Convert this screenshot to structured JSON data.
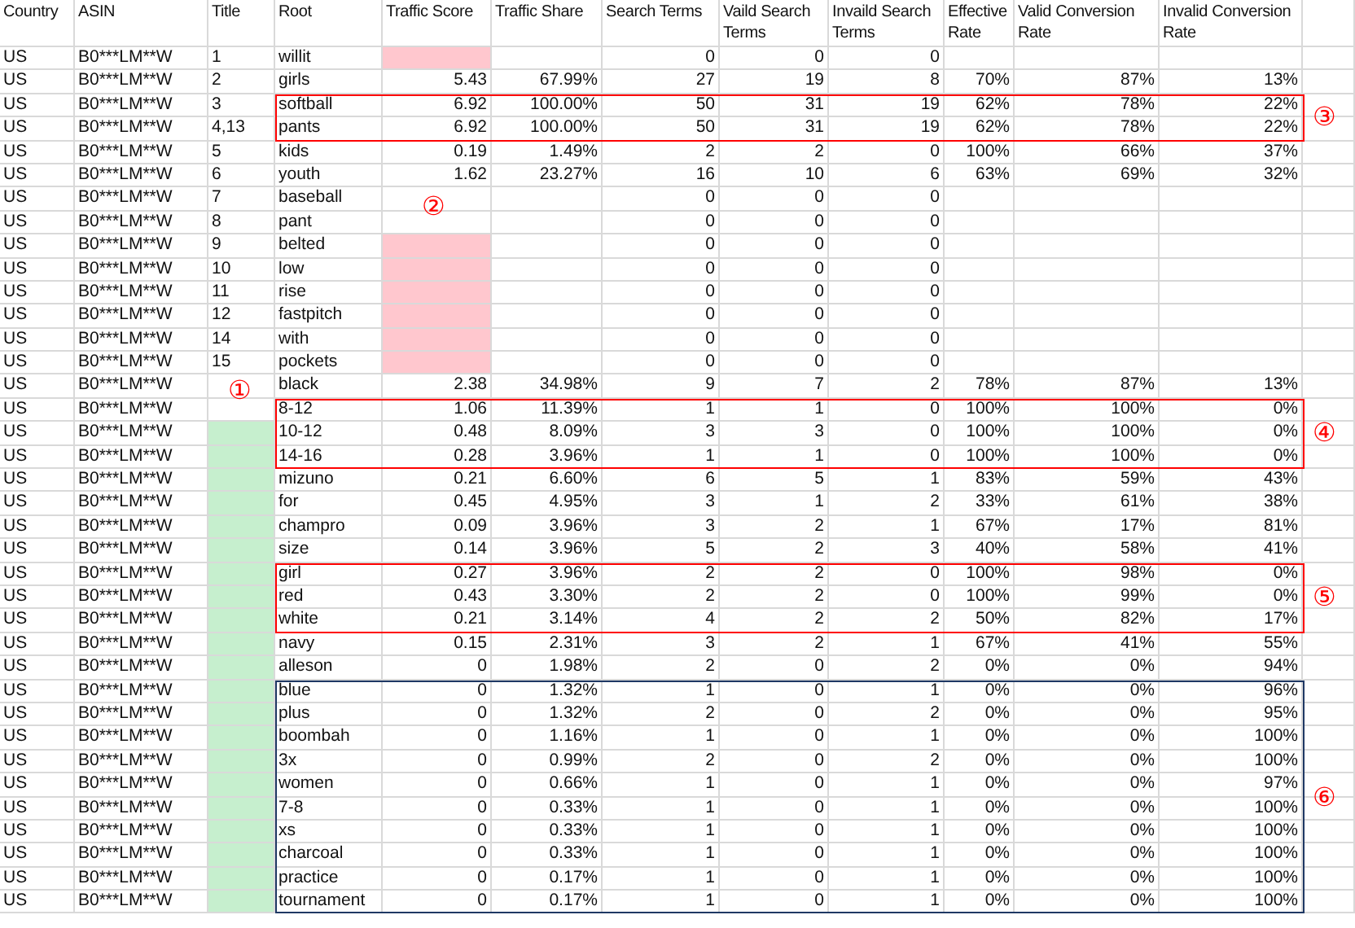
{
  "table": {
    "columns": [
      {
        "label": "Country"
      },
      {
        "label": "ASIN"
      },
      {
        "label": "Title"
      },
      {
        "label": "Root"
      },
      {
        "label": "Traffic Score"
      },
      {
        "label": "Traffic Share"
      },
      {
        "label": "Search Terms"
      },
      {
        "label": "Vaild Search Terms"
      },
      {
        "label": "Invaild Search Terms"
      },
      {
        "label": "Effective Rate"
      },
      {
        "label": "Valid Conversion Rate"
      },
      {
        "label": "Invalid Conversion Rate"
      }
    ],
    "sections": [
      {
        "rows": [
          {
            "country": "US",
            "asin": "B0***LM**W",
            "title": "1",
            "root": "willit",
            "score_highlight": true,
            "title_highlight": false,
            "search_terms": "0",
            "valid_search_terms": "0",
            "invalid_search_terms": "0"
          },
          {
            "country": "US",
            "asin": "B0***LM**W",
            "title": "2",
            "root": "girls",
            "score_highlight": false,
            "title_highlight": false,
            "traffic_score": "5.43",
            "traffic_share": "67.99%",
            "search_terms": "27",
            "valid_search_terms": "19",
            "invalid_search_terms": "8",
            "effective_rate": "70%",
            "valid_conversion_rate": "87%",
            "invalid_conversion_rate": "13%"
          }
        ]
      },
      {
        "box": {
          "label": "③",
          "color": "#ff0000"
        },
        "rows": [
          {
            "country": "US",
            "asin": "B0***LM**W",
            "title": "3",
            "root": "softball",
            "score_highlight": false,
            "title_highlight": false,
            "traffic_score": "6.92",
            "traffic_share": "100.00%",
            "search_terms": "50",
            "valid_search_terms": "31",
            "invalid_search_terms": "19",
            "effective_rate": "62%",
            "valid_conversion_rate": "78%",
            "invalid_conversion_rate": "22%"
          },
          {
            "country": "US",
            "asin": "B0***LM**W",
            "title": "4,13",
            "root": "pants",
            "score_highlight": false,
            "title_highlight": false,
            "traffic_score": "6.92",
            "traffic_share": "100.00%",
            "search_terms": "50",
            "valid_search_terms": "31",
            "invalid_search_terms": "19",
            "effective_rate": "62%",
            "valid_conversion_rate": "78%",
            "invalid_conversion_rate": "22%"
          }
        ]
      },
      {
        "rows": [
          {
            "country": "US",
            "asin": "B0***LM**W",
            "title": "5",
            "root": "kids",
            "score_highlight": false,
            "title_highlight": false,
            "traffic_score": "0.19",
            "traffic_share": "1.49%",
            "search_terms": "2",
            "valid_search_terms": "2",
            "invalid_search_terms": "0",
            "effective_rate": "100%",
            "valid_conversion_rate": "66%",
            "invalid_conversion_rate": "37%"
          },
          {
            "country": "US",
            "asin": "B0***LM**W",
            "title": "6",
            "root": "youth",
            "score_highlight": false,
            "title_highlight": false,
            "traffic_score": "1.62",
            "traffic_share": "23.27%",
            "search_terms": "16",
            "valid_search_terms": "10",
            "invalid_search_terms": "6",
            "effective_rate": "63%",
            "valid_conversion_rate": "69%",
            "invalid_conversion_rate": "32%"
          },
          {
            "country": "US",
            "asin": "B0***LM**W",
            "title": "7",
            "root": "baseball",
            "score_highlight": false,
            "title_highlight": false,
            "score_note": "②",
            "search_terms": "0",
            "valid_search_terms": "0",
            "invalid_search_terms": "0"
          },
          {
            "country": "US",
            "asin": "B0***LM**W",
            "title": "8",
            "root": "pant",
            "score_highlight": false,
            "title_highlight": false,
            "search_terms": "0",
            "valid_search_terms": "0",
            "invalid_search_terms": "0"
          },
          {
            "country": "US",
            "asin": "B0***LM**W",
            "title": "9",
            "root": "belted",
            "score_highlight": true,
            "title_highlight": false,
            "search_terms": "0",
            "valid_search_terms": "0",
            "invalid_search_terms": "0"
          },
          {
            "country": "US",
            "asin": "B0***LM**W",
            "title": "10",
            "root": "low",
            "score_highlight": true,
            "title_highlight": false,
            "search_terms": "0",
            "valid_search_terms": "0",
            "invalid_search_terms": "0"
          },
          {
            "country": "US",
            "asin": "B0***LM**W",
            "title": "11",
            "root": "rise",
            "score_highlight": true,
            "title_highlight": false,
            "search_terms": "0",
            "valid_search_terms": "0",
            "invalid_search_terms": "0"
          },
          {
            "country": "US",
            "asin": "B0***LM**W",
            "title": "12",
            "root": "fastpitch",
            "score_highlight": true,
            "title_highlight": false,
            "search_terms": "0",
            "valid_search_terms": "0",
            "invalid_search_terms": "0"
          },
          {
            "country": "US",
            "asin": "B0***LM**W",
            "title": "14",
            "root": "with",
            "score_highlight": true,
            "title_highlight": false,
            "search_terms": "0",
            "valid_search_terms": "0",
            "invalid_search_terms": "0"
          },
          {
            "country": "US",
            "asin": "B0***LM**W",
            "title": "15",
            "root": "pockets",
            "score_highlight": true,
            "title_highlight": false,
            "search_terms": "0",
            "valid_search_terms": "0",
            "invalid_search_terms": "0"
          },
          {
            "country": "US",
            "asin": "B0***LM**W",
            "root": "black",
            "score_highlight": false,
            "title_highlight": false,
            "title_note": "①",
            "traffic_score": "2.38",
            "traffic_share": "34.98%",
            "search_terms": "9",
            "valid_search_terms": "7",
            "invalid_search_terms": "2",
            "effective_rate": "78%",
            "valid_conversion_rate": "87%",
            "invalid_conversion_rate": "13%"
          }
        ]
      },
      {
        "box": {
          "label": "④",
          "color": "#ff0000"
        },
        "rows": [
          {
            "country": "US",
            "asin": "B0***LM**W",
            "root": "8-12",
            "score_highlight": false,
            "title_highlight": false,
            "traffic_score": "1.06",
            "traffic_share": "11.39%",
            "search_terms": "1",
            "valid_search_terms": "1",
            "invalid_search_terms": "0",
            "effective_rate": "100%",
            "valid_conversion_rate": "100%",
            "invalid_conversion_rate": "0%"
          },
          {
            "country": "US",
            "asin": "B0***LM**W",
            "root": "10-12",
            "score_highlight": false,
            "title_highlight": true,
            "traffic_score": "0.48",
            "traffic_share": "8.09%",
            "search_terms": "3",
            "valid_search_terms": "3",
            "invalid_search_terms": "0",
            "effective_rate": "100%",
            "valid_conversion_rate": "100%",
            "invalid_conversion_rate": "0%"
          },
          {
            "country": "US",
            "asin": "B0***LM**W",
            "root": "14-16",
            "score_highlight": false,
            "title_highlight": true,
            "traffic_score": "0.28",
            "traffic_share": "3.96%",
            "search_terms": "1",
            "valid_search_terms": "1",
            "invalid_search_terms": "0",
            "effective_rate": "100%",
            "valid_conversion_rate": "100%",
            "invalid_conversion_rate": "0%"
          }
        ]
      },
      {
        "rows": [
          {
            "country": "US",
            "asin": "B0***LM**W",
            "root": "mizuno",
            "score_highlight": false,
            "title_highlight": true,
            "traffic_score": "0.21",
            "traffic_share": "6.60%",
            "search_terms": "6",
            "valid_search_terms": "5",
            "invalid_search_terms": "1",
            "effective_rate": "83%",
            "valid_conversion_rate": "59%",
            "invalid_conversion_rate": "43%"
          },
          {
            "country": "US",
            "asin": "B0***LM**W",
            "root": "for",
            "score_highlight": false,
            "title_highlight": true,
            "traffic_score": "0.45",
            "traffic_share": "4.95%",
            "search_terms": "3",
            "valid_search_terms": "1",
            "invalid_search_terms": "2",
            "effective_rate": "33%",
            "valid_conversion_rate": "61%",
            "invalid_conversion_rate": "38%"
          },
          {
            "country": "US",
            "asin": "B0***LM**W",
            "root": "champro",
            "score_highlight": false,
            "title_highlight": true,
            "traffic_score": "0.09",
            "traffic_share": "3.96%",
            "search_terms": "3",
            "valid_search_terms": "2",
            "invalid_search_terms": "1",
            "effective_rate": "67%",
            "valid_conversion_rate": "17%",
            "invalid_conversion_rate": "81%"
          },
          {
            "country": "US",
            "asin": "B0***LM**W",
            "root": "size",
            "score_highlight": false,
            "title_highlight": true,
            "traffic_score": "0.14",
            "traffic_share": "3.96%",
            "search_terms": "5",
            "valid_search_terms": "2",
            "invalid_search_terms": "3",
            "effective_rate": "40%",
            "valid_conversion_rate": "58%",
            "invalid_conversion_rate": "41%"
          }
        ]
      },
      {
        "box": {
          "label": "⑤",
          "color": "#ff0000"
        },
        "rows": [
          {
            "country": "US",
            "asin": "B0***LM**W",
            "root": "girl",
            "score_highlight": false,
            "title_highlight": true,
            "traffic_score": "0.27",
            "traffic_share": "3.96%",
            "search_terms": "2",
            "valid_search_terms": "2",
            "invalid_search_terms": "0",
            "effective_rate": "100%",
            "valid_conversion_rate": "98%",
            "invalid_conversion_rate": "0%"
          },
          {
            "country": "US",
            "asin": "B0***LM**W",
            "root": "red",
            "score_highlight": false,
            "title_highlight": true,
            "traffic_score": "0.43",
            "traffic_share": "3.30%",
            "search_terms": "2",
            "valid_search_terms": "2",
            "invalid_search_terms": "0",
            "effective_rate": "100%",
            "valid_conversion_rate": "99%",
            "invalid_conversion_rate": "0%"
          },
          {
            "country": "US",
            "asin": "B0***LM**W",
            "root": "white",
            "score_highlight": false,
            "title_highlight": true,
            "traffic_score": "0.21",
            "traffic_share": "3.14%",
            "search_terms": "4",
            "valid_search_terms": "2",
            "invalid_search_terms": "2",
            "effective_rate": "50%",
            "valid_conversion_rate": "82%",
            "invalid_conversion_rate": "17%"
          }
        ]
      },
      {
        "rows": [
          {
            "country": "US",
            "asin": "B0***LM**W",
            "root": "navy",
            "score_highlight": false,
            "title_highlight": true,
            "traffic_score": "0.15",
            "traffic_share": "2.31%",
            "search_terms": "3",
            "valid_search_terms": "2",
            "invalid_search_terms": "1",
            "effective_rate": "67%",
            "valid_conversion_rate": "41%",
            "invalid_conversion_rate": "55%"
          },
          {
            "country": "US",
            "asin": "B0***LM**W",
            "root": "alleson",
            "score_highlight": false,
            "title_highlight": true,
            "traffic_score": "0",
            "traffic_share": "1.98%",
            "search_terms": "2",
            "valid_search_terms": "0",
            "invalid_search_terms": "2",
            "effective_rate": "0%",
            "valid_conversion_rate": "0%",
            "invalid_conversion_rate": "94%"
          }
        ]
      },
      {
        "box": {
          "label": "⑥",
          "color": "#1f3864"
        },
        "rows": [
          {
            "country": "US",
            "asin": "B0***LM**W",
            "root": "blue",
            "score_highlight": false,
            "title_highlight": true,
            "traffic_score": "0",
            "traffic_share": "1.32%",
            "search_terms": "1",
            "valid_search_terms": "0",
            "invalid_search_terms": "1",
            "effective_rate": "0%",
            "valid_conversion_rate": "0%",
            "invalid_conversion_rate": "96%"
          },
          {
            "country": "US",
            "asin": "B0***LM**W",
            "root": "plus",
            "score_highlight": false,
            "title_highlight": true,
            "traffic_score": "0",
            "traffic_share": "1.32%",
            "search_terms": "2",
            "valid_search_terms": "0",
            "invalid_search_terms": "2",
            "effective_rate": "0%",
            "valid_conversion_rate": "0%",
            "invalid_conversion_rate": "95%"
          },
          {
            "country": "US",
            "asin": "B0***LM**W",
            "root": "boombah",
            "score_highlight": false,
            "title_highlight": true,
            "traffic_score": "0",
            "traffic_share": "1.16%",
            "search_terms": "1",
            "valid_search_terms": "0",
            "invalid_search_terms": "1",
            "effective_rate": "0%",
            "valid_conversion_rate": "0%",
            "invalid_conversion_rate": "100%"
          },
          {
            "country": "US",
            "asin": "B0***LM**W",
            "root": "3x",
            "score_highlight": false,
            "title_highlight": true,
            "traffic_score": "0",
            "traffic_share": "0.99%",
            "search_terms": "2",
            "valid_search_terms": "0",
            "invalid_search_terms": "2",
            "effective_rate": "0%",
            "valid_conversion_rate": "0%",
            "invalid_conversion_rate": "100%"
          },
          {
            "country": "US",
            "asin": "B0***LM**W",
            "root": "women",
            "score_highlight": false,
            "title_highlight": true,
            "traffic_score": "0",
            "traffic_share": "0.66%",
            "search_terms": "1",
            "valid_search_terms": "0",
            "invalid_search_terms": "1",
            "effective_rate": "0%",
            "valid_conversion_rate": "0%",
            "invalid_conversion_rate": "97%"
          },
          {
            "country": "US",
            "asin": "B0***LM**W",
            "root": "7-8",
            "score_highlight": false,
            "title_highlight": true,
            "traffic_score": "0",
            "traffic_share": "0.33%",
            "search_terms": "1",
            "valid_search_terms": "0",
            "invalid_search_terms": "1",
            "effective_rate": "0%",
            "valid_conversion_rate": "0%",
            "invalid_conversion_rate": "100%"
          },
          {
            "country": "US",
            "asin": "B0***LM**W",
            "root": "xs",
            "score_highlight": false,
            "title_highlight": true,
            "traffic_score": "0",
            "traffic_share": "0.33%",
            "search_terms": "1",
            "valid_search_terms": "0",
            "invalid_search_terms": "1",
            "effective_rate": "0%",
            "valid_conversion_rate": "0%",
            "invalid_conversion_rate": "100%"
          },
          {
            "country": "US",
            "asin": "B0***LM**W",
            "root": "charcoal",
            "score_highlight": false,
            "title_highlight": true,
            "traffic_score": "0",
            "traffic_share": "0.33%",
            "search_terms": "1",
            "valid_search_terms": "0",
            "invalid_search_terms": "1",
            "effective_rate": "0%",
            "valid_conversion_rate": "0%",
            "invalid_conversion_rate": "100%"
          },
          {
            "country": "US",
            "asin": "B0***LM**W",
            "root": "practice",
            "score_highlight": false,
            "title_highlight": true,
            "traffic_score": "0",
            "traffic_share": "0.17%",
            "search_terms": "1",
            "valid_search_terms": "0",
            "invalid_search_terms": "1",
            "effective_rate": "0%",
            "valid_conversion_rate": "0%",
            "invalid_conversion_rate": "100%"
          },
          {
            "country": "US",
            "asin": "B0***LM**W",
            "root": "tournament",
            "score_highlight": false,
            "title_highlight": true,
            "traffic_score": "0",
            "traffic_share": "0.17%",
            "search_terms": "1",
            "valid_search_terms": "0",
            "invalid_search_terms": "1",
            "effective_rate": "0%",
            "valid_conversion_rate": "0%",
            "invalid_conversion_rate": "100%"
          }
        ]
      }
    ]
  }
}
